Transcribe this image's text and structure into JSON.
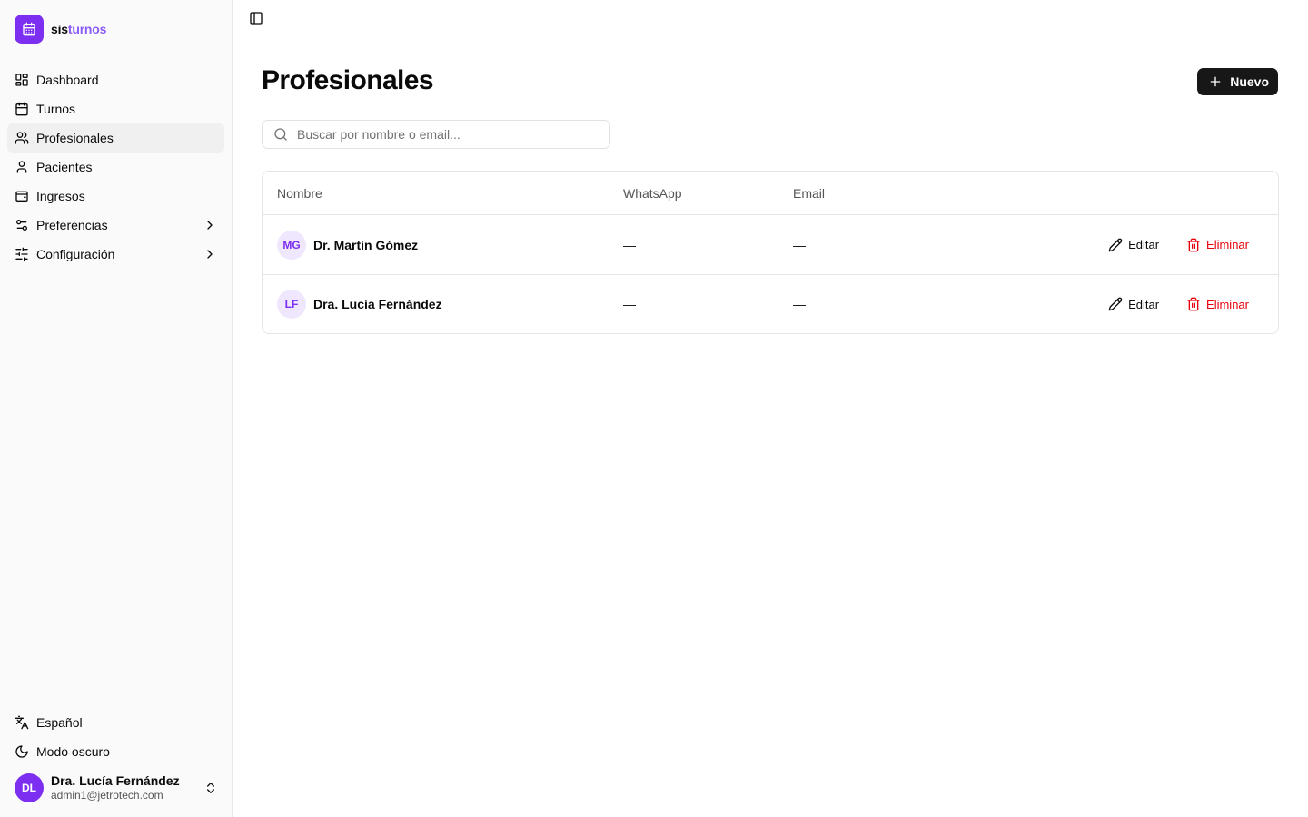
{
  "brand": {
    "name_part1": "sis",
    "name_part2": "turnos",
    "accent": "#7c2ff0"
  },
  "sidebar": {
    "items": [
      {
        "label": "Dashboard",
        "icon": "layout-dashboard-icon"
      },
      {
        "label": "Turnos",
        "icon": "calendar-icon"
      },
      {
        "label": "Profesionales",
        "icon": "users-icon",
        "active": true
      },
      {
        "label": "Pacientes",
        "icon": "user-icon"
      },
      {
        "label": "Ingresos",
        "icon": "wallet-icon"
      },
      {
        "label": "Preferencias",
        "icon": "settings-toggle-icon",
        "has_children": true
      },
      {
        "label": "Configuración",
        "icon": "sliders-icon",
        "has_children": true
      }
    ],
    "footer": {
      "language": "Español",
      "theme": "Modo oscuro"
    },
    "user": {
      "initials": "DL",
      "name": "Dra. Lucía Fernández",
      "email": "admin1@jetrotech.com"
    }
  },
  "main": {
    "title": "Profesionales",
    "new_button": "Nuevo",
    "search": {
      "placeholder": "Buscar por nombre o email..."
    },
    "table": {
      "columns": [
        "Nombre",
        "WhatsApp",
        "Email"
      ],
      "rows": [
        {
          "initials": "MG",
          "name": "Dr. Martín Gómez",
          "whatsapp": "—",
          "email": "—",
          "edit": "Editar",
          "delete": "Eliminar"
        },
        {
          "initials": "LF",
          "name": "Dra. Lucía Fernández",
          "whatsapp": "—",
          "email": "—",
          "edit": "Editar",
          "delete": "Eliminar"
        }
      ]
    }
  },
  "colors": {
    "danger": "#e7000b",
    "primary_button": "#171717"
  }
}
